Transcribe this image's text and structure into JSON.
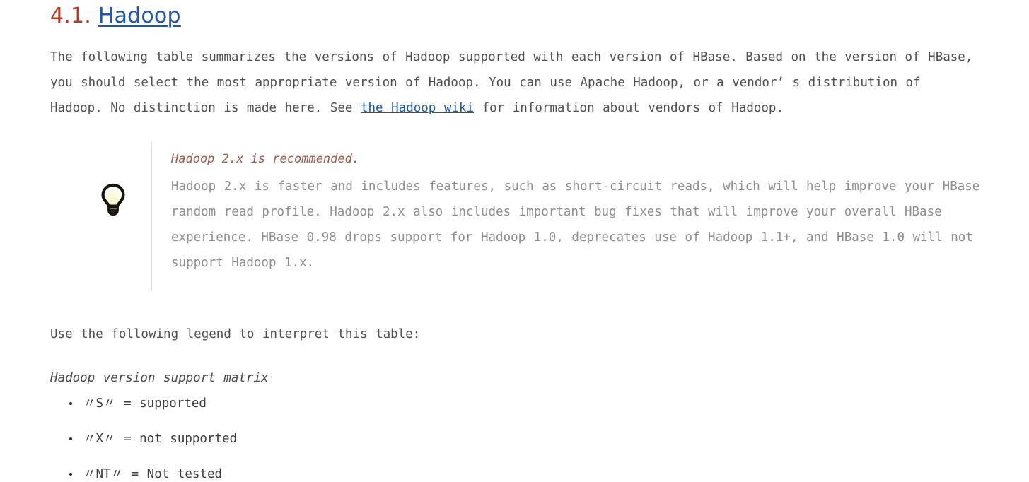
{
  "heading": {
    "number": "4.1.",
    "link_text": "Hadoop",
    "number_color": "#ba3925",
    "link_color": "#2156a5"
  },
  "intro": {
    "part1": "The following table summarizes the versions of Hadoop supported with each version of HBase. Based on the version of HBase, you should select the most appropriate version of Hadoop. You can use Apache Hadoop, or a vendor’ s distribution of Hadoop. No distinction is made here. See ",
    "link_text": "the Hadoop wiki",
    "part2": " for information about vendors of Hadoop."
  },
  "tip": {
    "icon": "lightbulb-icon",
    "title": "Hadoop 2.x is recommended.",
    "title_color": "#9a5a4a",
    "body": "Hadoop 2.x is faster and includes features, such as short-circuit reads, which will help improve your HBase random read profile. Hadoop 2.x also includes important bug fixes that will improve your overall HBase experience. HBase 0.98 drops support for Hadoop 1.0, deprecates use of Hadoop 1.1+, and HBase 1.0 will not support Hadoop 1.x.",
    "body_color": "#8d8d8d"
  },
  "legend": {
    "intro": "Use the following legend to interpret this table:",
    "caption": "Hadoop version support matrix",
    "items": [
      "〃S〃 = supported",
      "〃X〃 = not supported",
      "〃NT〃 = Not tested"
    ]
  }
}
